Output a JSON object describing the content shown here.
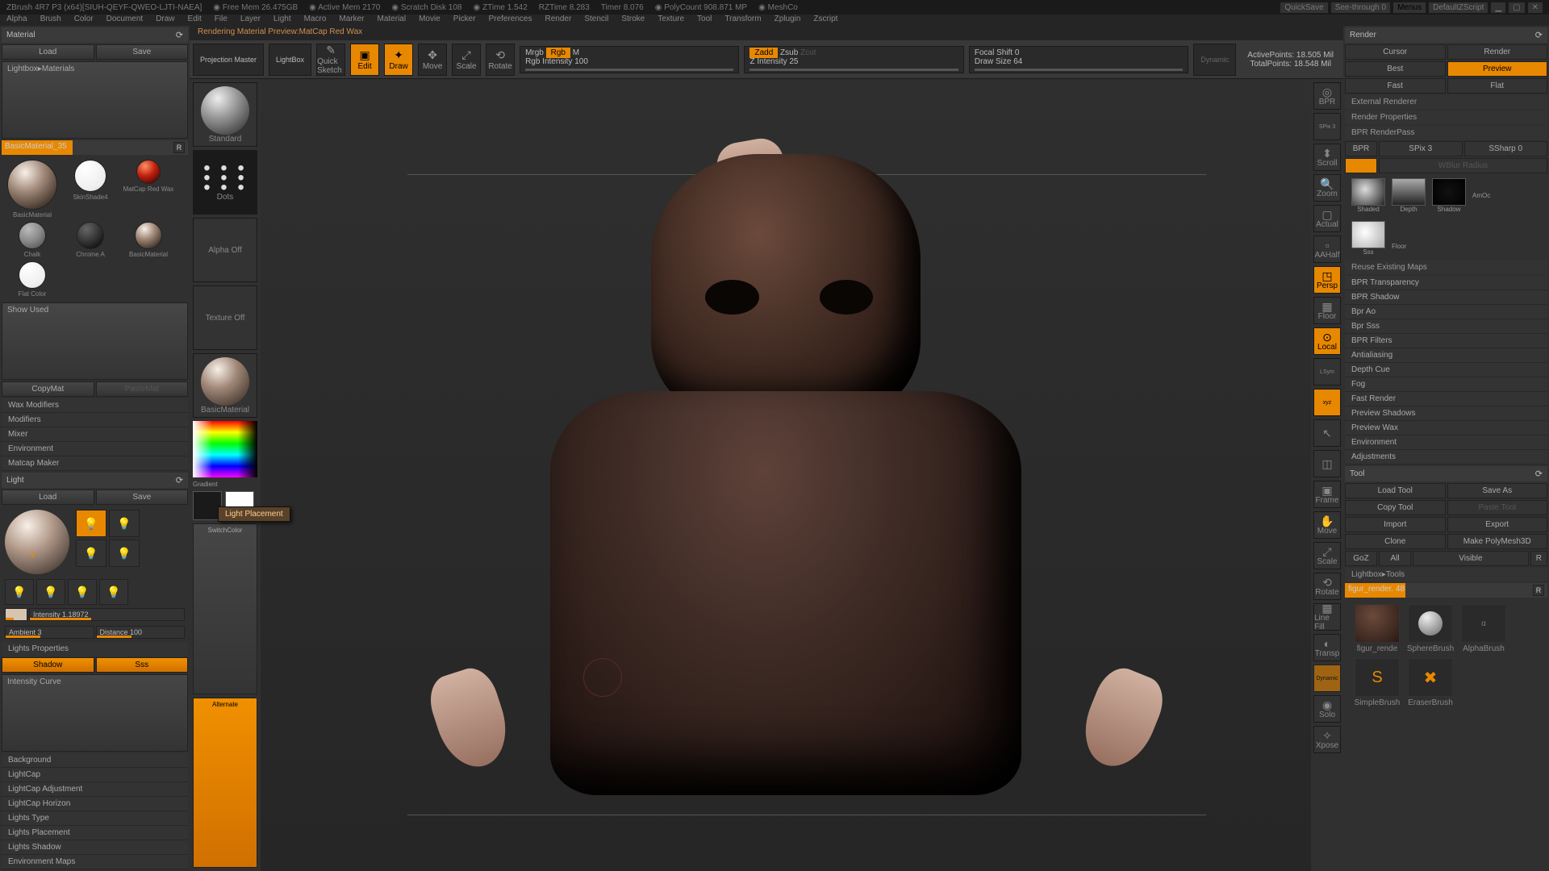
{
  "title_bar": {
    "app": "ZBrush 4R7 P3 (x64)[SIUH-QEYF-QWEO-LJTI-NAEA]",
    "free_mem": "Free Mem 26.475GB",
    "active_mem": "Active Mem 2170",
    "scratch": "Scratch Disk 108",
    "ztime": "ZTime 1.542",
    "rztime": "RZTime 8.283",
    "timer": "Timer 8.076",
    "polycount": "PolyCount 908.871 MP",
    "meshcount": "MeshCo",
    "quicksave": "QuickSave",
    "seethrough": "See-through 0",
    "menus": "Menus",
    "script": "DefaultZScript"
  },
  "menu": [
    "Alpha",
    "Brush",
    "Color",
    "Document",
    "Draw",
    "Edit",
    "File",
    "Layer",
    "Light",
    "Macro",
    "Marker",
    "Material",
    "Movie",
    "Picker",
    "Preferences",
    "Render",
    "Stencil",
    "Stroke",
    "Texture",
    "Tool",
    "Transform",
    "Zplugin",
    "Zscript"
  ],
  "status_line": "Rendering Material Preview:MatCap Red Wax",
  "toolbar": {
    "projection": "Projection Master",
    "lightbox": "LightBox",
    "quicksketch": "Quick Sketch",
    "edit": "Edit",
    "draw": "Draw",
    "move": "Move",
    "scale": "Scale",
    "rotate": "Rotate",
    "mrgb": "Mrgb",
    "rgb": "Rgb",
    "m": "M",
    "rgb_intensity": "Rgb Intensity 100",
    "zadd": "Zadd",
    "zsub": "Zsub",
    "zcut": "Zcut",
    "z_intensity": "Z Intensity 25",
    "focal": "Focal Shift 0",
    "drawsize": "Draw Size 64",
    "dynamic": "Dynamic",
    "active_pts": "ActivePoints: 18.505 Mil",
    "total_pts": "TotalPoints: 18.548 Mil"
  },
  "material": {
    "title": "Material",
    "load": "Load",
    "save": "Save",
    "lightbox": "Lightbox▸Materials",
    "basic": "BasicMaterial_35",
    "r_badge": "R",
    "swatches": [
      "BasicMaterial",
      "SkinShade4",
      "MatCap Red Wax",
      "Chalk",
      "Chrome A",
      "BasicMaterial",
      "Flat Color"
    ],
    "show_used": "Show Used",
    "copymat": "CopyMat",
    "pastemat": "PasteMat",
    "sections": [
      "Wax Modifiers",
      "Modifiers",
      "Mixer",
      "Environment",
      "Matcap Maker"
    ]
  },
  "light": {
    "title": "Light",
    "load": "Load",
    "save": "Save",
    "intensity": "Intensity 1.18972",
    "ambient": "Ambient 3",
    "distance": "Distance 100",
    "props": "Lights Properties",
    "shadow": "Shadow",
    "sss": "Sss",
    "curve": "Intensity Curve",
    "sections": [
      "Background",
      "LightCap",
      "LightCap Adjustment",
      "LightCap Horizon",
      "Lights Type",
      "Lights Placement",
      "Lights Shadow",
      "Environment Maps"
    ]
  },
  "tray": {
    "standard": "Standard",
    "dots": "Dots",
    "alpha": "Alpha Off",
    "texture": "Texture Off",
    "basicmat": "BasicMaterial",
    "gradient": "Gradient",
    "switchcolor": "SwitchColor",
    "alternate": "Alternate"
  },
  "tooltip": "Light Placement",
  "right_dock": {
    "bpr": "BPR",
    "spix": "SPix 3",
    "scroll": "Scroll",
    "zoom": "Zoom",
    "actual": "Actual",
    "aahalf": "AAHalf",
    "persp": "Persp",
    "floor": "Floor",
    "local": "Local",
    "lsym": "LSym",
    "xyz": "xyz",
    "frame": "Frame",
    "move": "Move",
    "scale": "Scale",
    "rotate": "Rotate",
    "linefill": "Line Fill",
    "transp": "Transp",
    "dynamic": "Dynamic",
    "solo": "Solo",
    "xpose": "Xpose"
  },
  "render": {
    "title": "Render",
    "cursor": "Cursor",
    "render_lbl": "Render",
    "best": "Best",
    "preview": "Preview",
    "fast": "Fast",
    "flat": "Flat",
    "ext_render": "External Renderer",
    "render_props": "Render Properties",
    "bpr_renderpass": "BPR RenderPass",
    "spix": "SPix 3",
    "ssharp": "SSharp 0",
    "wblur": "WBlur Radius",
    "passes": {
      "shaded": "Shaded",
      "depth": "Depth",
      "shadow": "Shadow",
      "amoc": "AmOc",
      "sss": "Sss",
      "floor": "Floor"
    },
    "reuse": "Reuse Existing Maps",
    "sections": [
      "BPR Transparency",
      "BPR Shadow",
      "Bpr Ao",
      "Bpr Sss",
      "BPR Filters",
      "Antialiasing",
      "Depth Cue",
      "Fog",
      "Fast Render",
      "Preview Shadows",
      "Preview Wax",
      "Environment",
      "Adjustments"
    ]
  },
  "tool": {
    "title": "Tool",
    "load": "Load Tool",
    "save": "Save As",
    "copy": "Copy Tool",
    "paste": "Paste Tool",
    "import": "Import",
    "export": "Export",
    "clone": "Clone",
    "makepoly": "Make PolyMesh3D",
    "goz": "GoZ",
    "all": "All",
    "visible": "Visible",
    "r": "R",
    "lightbox": "Lightbox▸Tools",
    "current": "figur_render. 48",
    "r2": "R",
    "brushes": [
      "figur_rende",
      "SphereBrush",
      "SimpleBrush",
      "AlphaBrush",
      "EraserBrush"
    ]
  }
}
